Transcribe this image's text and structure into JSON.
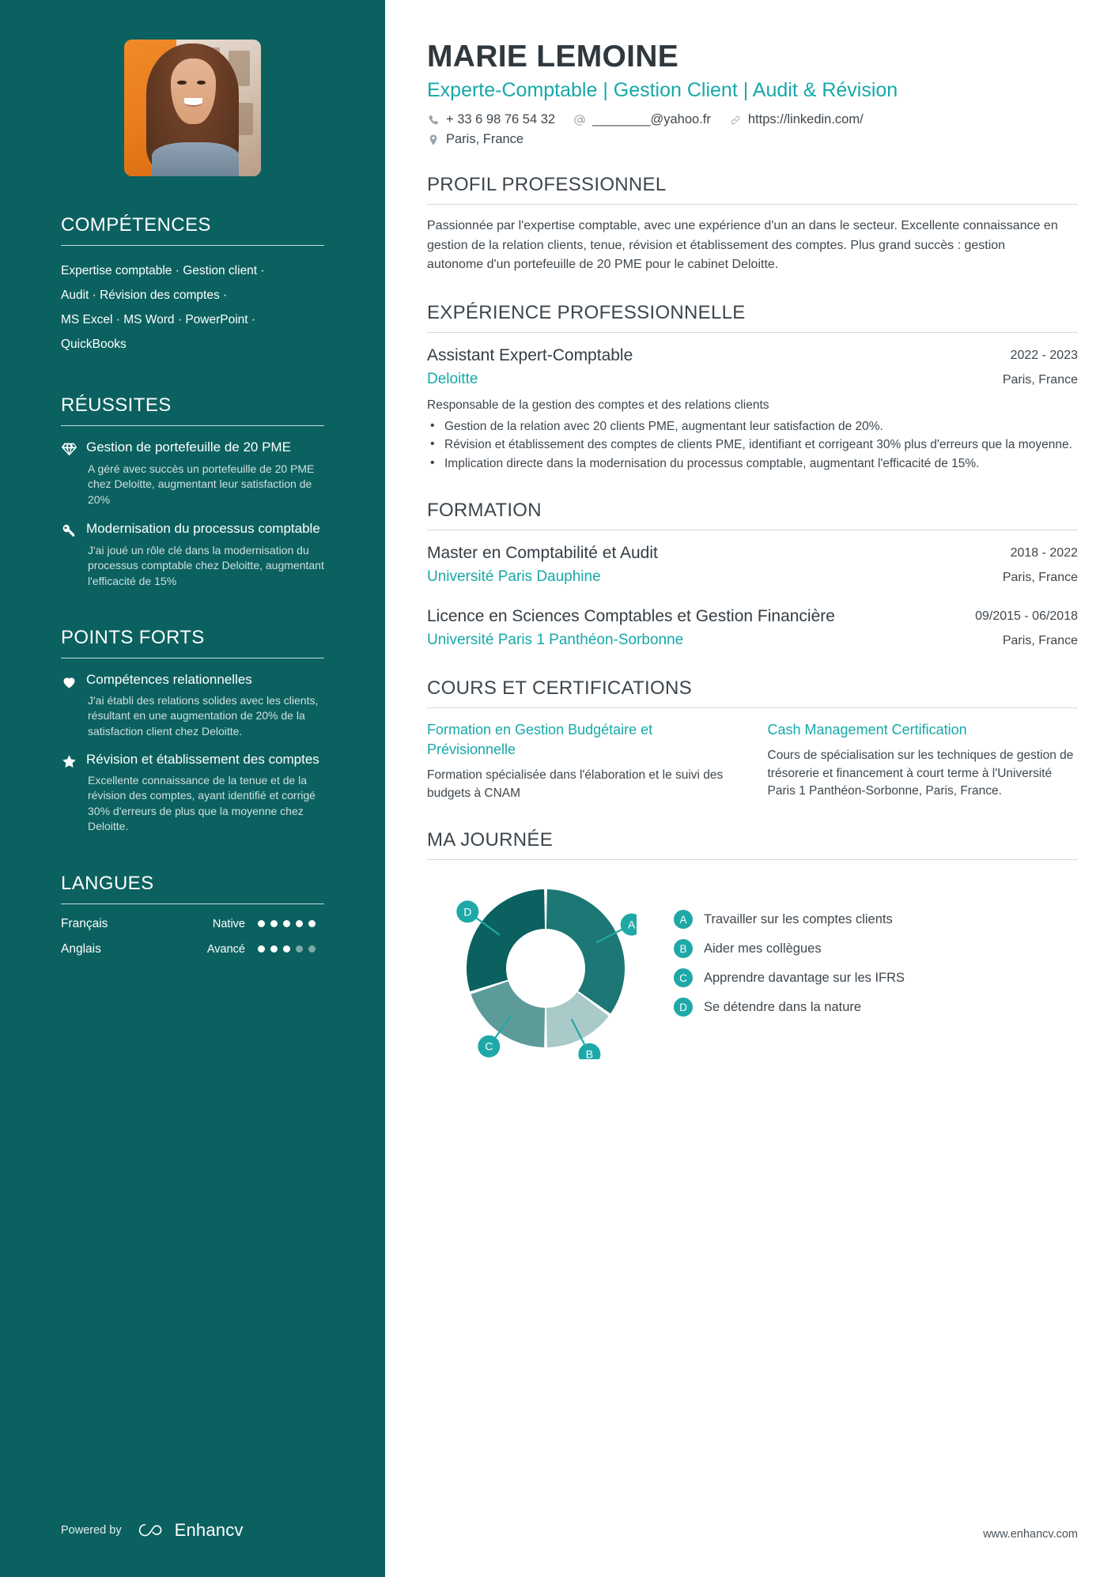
{
  "header": {
    "name": "MARIE LEMOINE",
    "headline": "Experte-Comptable | Gestion Client | Audit & Révision",
    "contact": {
      "phone": "+ 33 6 98 76 54 32",
      "email": "________@yahoo.fr",
      "linkedin": "https://linkedin.com/",
      "location": "Paris, France"
    }
  },
  "sidebar": {
    "skills": {
      "heading": "COMPÉTENCES",
      "lines": [
        "Expertise comptable · Gestion client ·",
        "Audit · Révision des comptes ·",
        "MS Excel · MS Word · PowerPoint ·",
        "QuickBooks"
      ]
    },
    "achievements": {
      "heading": "RÉUSSITES",
      "items": [
        {
          "icon": "diamond-icon",
          "title": "Gestion de portefeuille de 20 PME",
          "description": "A géré avec succès un portefeuille de 20 PME chez Deloitte, augmentant leur satisfaction de 20%"
        },
        {
          "icon": "key-icon",
          "title": "Modernisation du processus comptable",
          "description": "J'ai joué un rôle clé dans la modernisation du processus comptable chez Deloitte, augmentant l'efficacité de 15%"
        }
      ]
    },
    "strengths": {
      "heading": "POINTS FORTS",
      "items": [
        {
          "icon": "heart-icon",
          "title": "Compétences relationnelles",
          "description": "J'ai établi des relations solides avec les clients, résultant en une augmentation de 20% de la satisfaction client chez Deloitte."
        },
        {
          "icon": "star-icon",
          "title": "Révision et établissement des comptes",
          "description": "Excellente connaissance de la tenue et de la révision des comptes, ayant identifié et corrigé 30% d'erreurs de plus que la moyenne chez Deloitte."
        }
      ]
    },
    "languages": {
      "heading": "LANGUES",
      "items": [
        {
          "name": "Français",
          "level": "Native",
          "filled": 5,
          "total": 5
        },
        {
          "name": "Anglais",
          "level": "Avancé",
          "filled": 3,
          "total": 5
        }
      ]
    },
    "footer": {
      "powered_by": "Powered by",
      "brand": "Enhancv"
    }
  },
  "main": {
    "profile": {
      "heading": "PROFIL PROFESSIONNEL",
      "text": "Passionnée par l'expertise comptable, avec une expérience d'un an dans le secteur. Excellente connaissance en gestion de la relation clients, tenue, révision et établissement des comptes. Plus grand succès : gestion autonome d'un portefeuille de 20 PME pour le cabinet Deloitte."
    },
    "experience": {
      "heading": "EXPÉRIENCE PROFESSIONNELLE",
      "entries": [
        {
          "title": "Assistant Expert-Comptable",
          "dates": "2022 - 2023",
          "organization": "Deloitte",
          "location": "Paris, France",
          "summary": "Responsable de la gestion des comptes et des relations clients",
          "bullets": [
            "Gestion de la relation avec 20 clients PME, augmentant leur satisfaction de 20%.",
            "Révision et établissement des comptes de clients PME, identifiant et corrigeant 30% plus d'erreurs que la moyenne.",
            "Implication directe dans la modernisation du processus comptable, augmentant l'efficacité de 15%."
          ]
        }
      ]
    },
    "education": {
      "heading": "FORMATION",
      "entries": [
        {
          "title": "Master en Comptabilité et Audit",
          "dates": "2018 - 2022",
          "organization": "Université Paris Dauphine",
          "location": "Paris, France"
        },
        {
          "title": "Licence en Sciences Comptables et Gestion Financière",
          "dates": "09/2015 - 06/2018",
          "organization": "Université Paris 1 Panthéon-Sorbonne",
          "location": "Paris, France"
        }
      ]
    },
    "courses": {
      "heading": "COURS ET CERTIFICATIONS",
      "items": [
        {
          "title": "Formation en Gestion Budgétaire et Prévisionnelle",
          "description": "Formation spécialisée dans l'élaboration et le suivi des budgets à CNAM"
        },
        {
          "title": "Cash Management Certification",
          "description": "Cours de spécialisation sur les techniques de gestion de trésorerie et financement à court terme à l'Université Paris 1 Panthéon-Sorbonne, Paris, France."
        }
      ]
    },
    "my_day": {
      "heading": "MA JOURNÉE"
    },
    "site_url": "www.enhancv.com"
  },
  "chart_data": {
    "type": "pie",
    "title": "MA JOURNÉE",
    "labels": [
      "A",
      "B",
      "C",
      "D"
    ],
    "categories": [
      "Travailler sur les comptes clients",
      "Aider mes collègues",
      "Apprendre davantage sur les IFRS",
      "Se détendre dans la nature"
    ],
    "values": [
      35,
      15,
      20,
      30
    ],
    "colors": [
      "#1c7775",
      "#a9cac8",
      "#5d9b99",
      "#0b6160"
    ],
    "legend": "right",
    "donut": true
  },
  "colors": {
    "sidebar_bg": "#0b6160",
    "accent_teal": "#17a8a8",
    "heading_dark": "#3d464d",
    "body_text": "#3e474e"
  }
}
